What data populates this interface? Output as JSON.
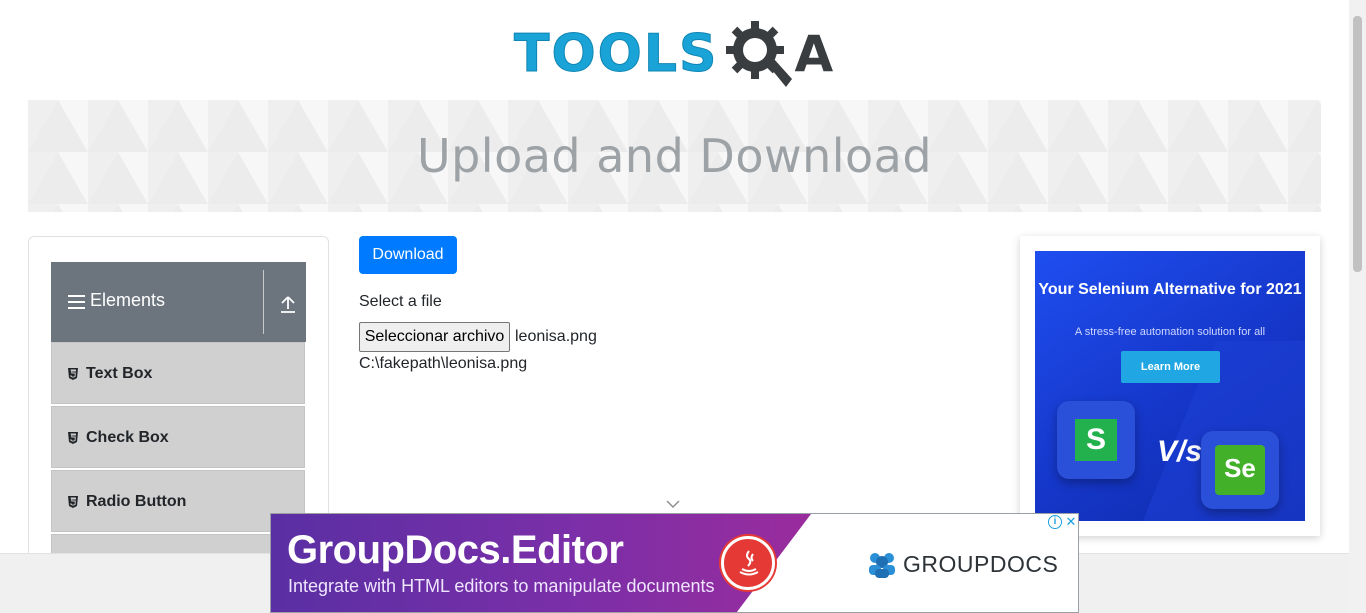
{
  "brand": {
    "logo_text": "TOOLSQA",
    "primary_color": "#1aa3d6",
    "dark_color": "#3a3d40"
  },
  "banner": {
    "title": "Upload and Download"
  },
  "sidebar": {
    "group": {
      "label": "Elements",
      "icon": "hamburger-icon",
      "toggle_icon": "collapse-icon"
    },
    "items": [
      {
        "label": "Text Box",
        "icon": "html5-icon"
      },
      {
        "label": "Check Box",
        "icon": "html5-icon"
      },
      {
        "label": "Radio Button",
        "icon": "html5-icon"
      }
    ]
  },
  "main": {
    "download_label": "Download",
    "select_label": "Select a file",
    "file_button_label": "Seleccionar archivo",
    "selected_file_name": "leonisa.png",
    "uploaded_path": "C:\\fakepath\\leonisa.png",
    "accent_color": "#007bff"
  },
  "side_ad": {
    "title": "Your Selenium Alternative for 2021",
    "subtitle": "A stress-free automation solution for all",
    "cta": "Learn More",
    "vs_text": "V/s",
    "left_logo_letter": "S",
    "right_logo_text": "Se"
  },
  "bottom_ad": {
    "title": "GroupDocs.Editor",
    "subtitle": "Integrate with HTML editors to manipulate documents",
    "brand": "GROUPDOCS",
    "adchoices_icon": "info-icon",
    "close_icon": "close-icon"
  }
}
